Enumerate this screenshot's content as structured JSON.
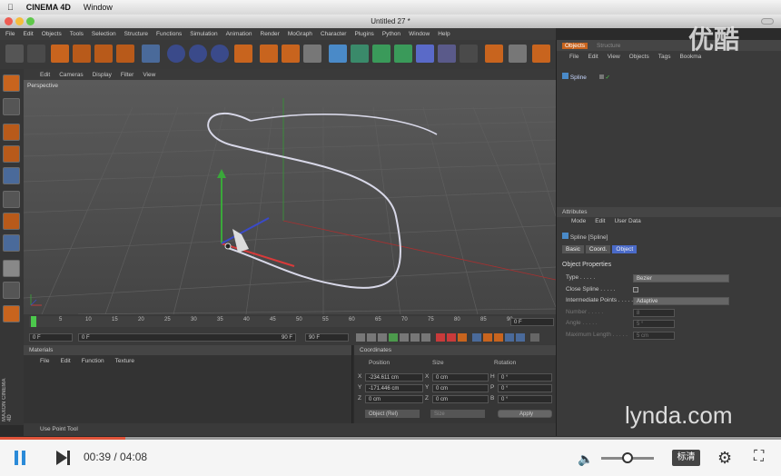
{
  "mac_menu": {
    "app": "CINEMA 4D",
    "window": "Window"
  },
  "window_title": "Untitled 27 *",
  "main_menu": [
    "File",
    "Edit",
    "Objects",
    "Tools",
    "Selection",
    "Structure",
    "Functions",
    "Simulation",
    "Animation",
    "Render",
    "MoGraph",
    "Character",
    "Plugins",
    "Python",
    "Window",
    "Help"
  ],
  "viewport": {
    "menu": [
      "Edit",
      "Cameras",
      "Display",
      "Filter",
      "View"
    ],
    "label": "Perspective"
  },
  "timeline": {
    "ticks": [
      "0",
      "5",
      "10",
      "15",
      "20",
      "25",
      "30",
      "35",
      "40",
      "45",
      "50",
      "55",
      "60",
      "65",
      "70",
      "75",
      "80",
      "85",
      "90"
    ],
    "current_frame": "0 F",
    "start": "0 F",
    "start_b": "0 F",
    "end_b": "90 F",
    "end": "90 F"
  },
  "materials": {
    "title": "Materials",
    "menu": [
      "File",
      "Edit",
      "Function",
      "Texture"
    ]
  },
  "coordinates": {
    "title": "Coordinates",
    "headers": [
      "Position",
      "Size",
      "Rotation"
    ],
    "rows": [
      {
        "axis": "X",
        "pos": "-234.611 cm",
        "size_axis": "X",
        "size": "0 cm",
        "rot_axis": "H",
        "rot": "0 °"
      },
      {
        "axis": "Y",
        "pos": "-171.446 cm",
        "size_axis": "Y",
        "size": "0 cm",
        "rot_axis": "P",
        "rot": "0 °"
      },
      {
        "axis": "Z",
        "pos": "0 cm",
        "size_axis": "Z",
        "size": "0 cm",
        "rot_axis": "B",
        "rot": "0 °"
      }
    ],
    "mode": "Object (Rel)",
    "size_mode": "Size",
    "apply": "Apply"
  },
  "status": "Use Point Tool",
  "objects_panel": {
    "tabs": [
      "Objects",
      "Structure"
    ],
    "menu": [
      "File",
      "Edit",
      "View",
      "Objects",
      "Tags",
      "Bookma"
    ],
    "item": "Spline"
  },
  "attributes": {
    "title": "Attributes",
    "menu": [
      "Mode",
      "Edit",
      "User Data"
    ],
    "object": "Spline [Spline]",
    "tabs": [
      "Basic",
      "Coord.",
      "Object"
    ],
    "section": "Object Properties",
    "props": [
      {
        "label": "Type",
        "value": "Bezier"
      },
      {
        "label": "Close Spline",
        "value": ""
      },
      {
        "label": "Intermediate Points",
        "value": "Adaptive"
      },
      {
        "label": "Number",
        "value": "8"
      },
      {
        "label": "Angle",
        "value": "5 °"
      },
      {
        "label": "Maximum Length",
        "value": "5 cm"
      }
    ]
  },
  "branding": {
    "watermark": "优酷",
    "lynda": "lynda.com",
    "maxon": "MAXON CINEMA 4D"
  },
  "player": {
    "time": "00:39 / 04:08",
    "quality": "标清",
    "progress": 0.16
  },
  "colors": {
    "accent": "#e0543a",
    "c4d_orange": "#c8641e",
    "spline": "#d8d8e8"
  }
}
